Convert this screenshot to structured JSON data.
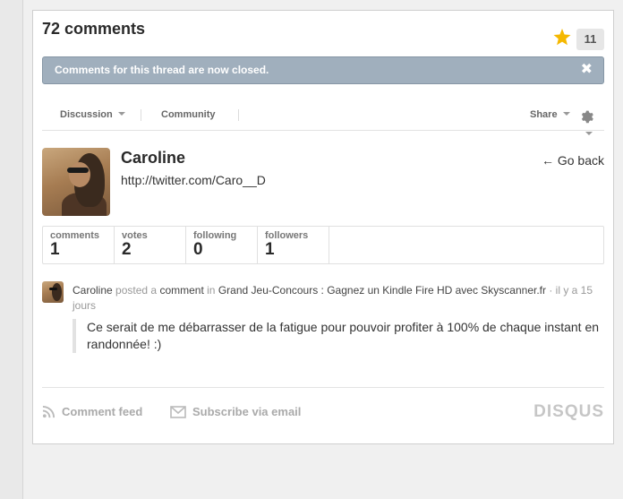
{
  "header": {
    "comment_count": "72 comments",
    "likes": "11"
  },
  "banner": {
    "text": "Comments for this thread are now closed.",
    "close_glyph": "✖"
  },
  "nav": {
    "discussion": "Discussion",
    "community": "Community",
    "share": "Share"
  },
  "profile": {
    "name": "Caroline",
    "url": "http://twitter.com/Caro__D",
    "go_back": "← Go back"
  },
  "stats": [
    {
      "label": "comments",
      "value": "1"
    },
    {
      "label": "votes",
      "value": "2"
    },
    {
      "label": "following",
      "value": "0"
    },
    {
      "label": "followers",
      "value": "1"
    }
  ],
  "activity": {
    "author": "Caroline",
    "verb": "posted a",
    "object": "comment",
    "preposition": "in",
    "thread": "Grand Jeu-Concours : Gagnez un Kindle Fire HD avec Skyscanner.fr",
    "time": "· il y a 15 jours",
    "comment_text": "Ce serait de me débarrasser de la fatigue pour pouvoir profiter à 100% de chaque instant en randonnée! :)"
  },
  "footer": {
    "comment_feed": "Comment feed",
    "subscribe": "Subscribe via email",
    "brand": "DISQUS"
  },
  "colors": {
    "star": "#f5b800",
    "banner_bg": "#a0afbd"
  },
  "icons": [
    "star-icon",
    "close-icon",
    "chevron-down-icon",
    "gear-icon",
    "rss-icon",
    "envelope-icon"
  ]
}
